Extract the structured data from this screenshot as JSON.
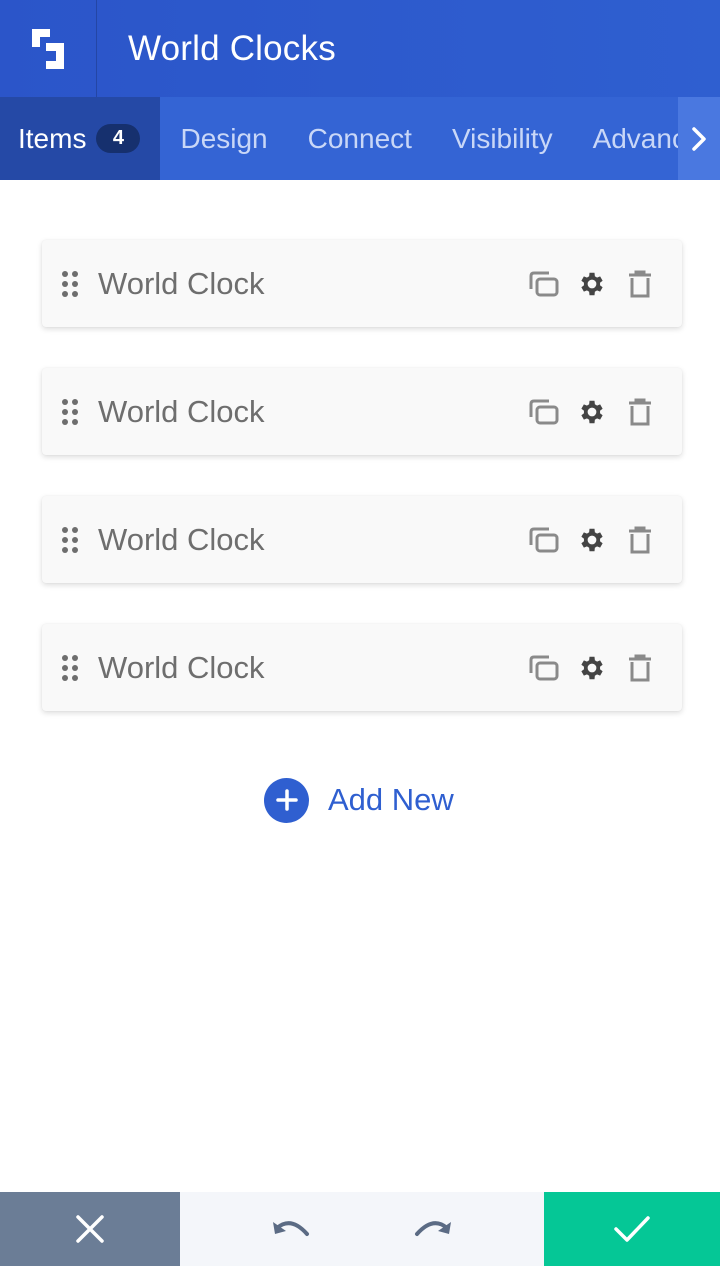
{
  "header": {
    "title": "World Clocks",
    "logo_icon": "builder-logo-icon"
  },
  "tabs": [
    {
      "label": "Items",
      "badge": "4",
      "active": true
    },
    {
      "label": "Design",
      "active": false
    },
    {
      "label": "Connect",
      "active": false
    },
    {
      "label": "Visibility",
      "active": false
    },
    {
      "label": "Advanced",
      "active": false
    }
  ],
  "items": [
    {
      "label": "World Clock"
    },
    {
      "label": "World Clock"
    },
    {
      "label": "World Clock"
    },
    {
      "label": "World Clock"
    }
  ],
  "add_new": {
    "label": "Add New"
  },
  "footer": {
    "cancel_icon": "close-icon",
    "undo_icon": "undo-icon",
    "redo_icon": "redo-icon",
    "save_icon": "check-icon"
  },
  "colors": {
    "header": "#2b55c9",
    "tabs": "#3464d4",
    "active_tab": "#2549a6",
    "accent": "#2f5fd0",
    "cancel": "#6b7d96",
    "save": "#05c796"
  }
}
